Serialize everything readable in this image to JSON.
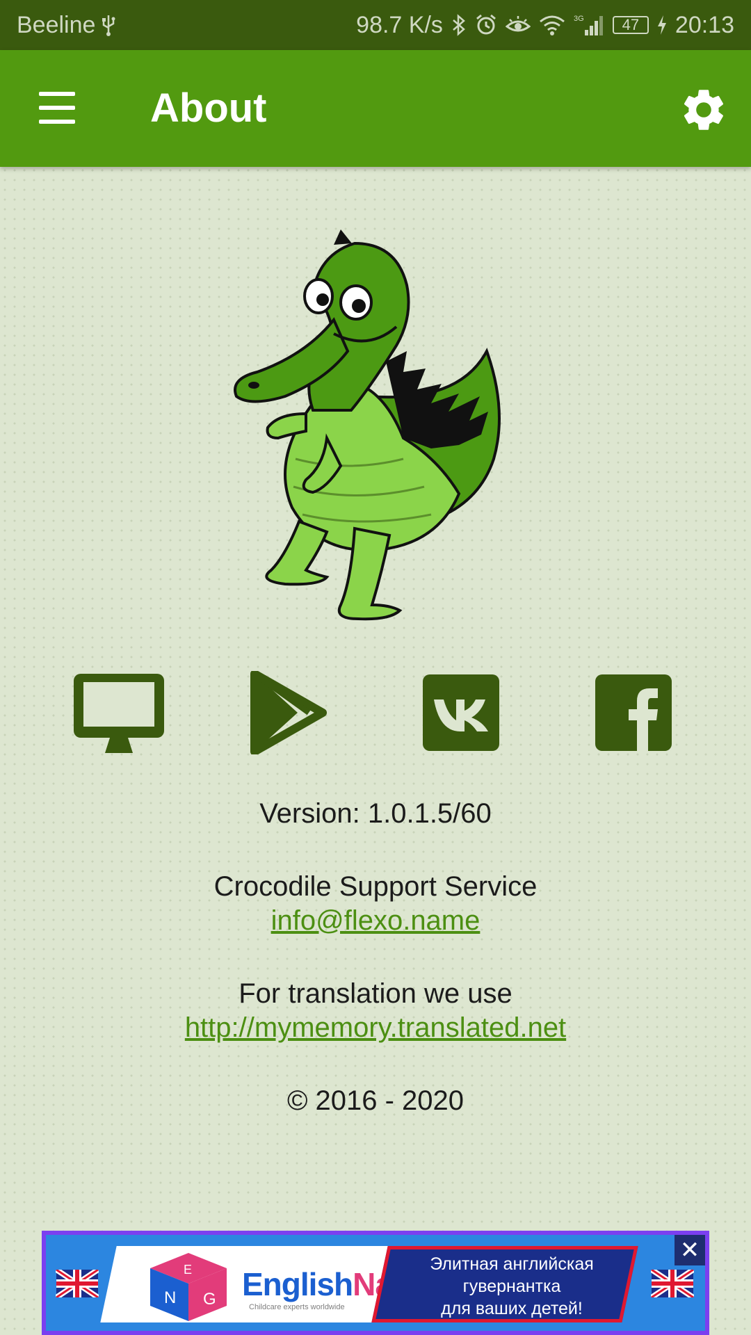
{
  "status_bar": {
    "carrier": "Beeline",
    "net_speed": "98.7 K/s",
    "network_type": "3G",
    "battery": "47",
    "time": "20:13"
  },
  "app_bar": {
    "title": "About"
  },
  "links": [
    {
      "name": "website",
      "icon": "monitor-icon"
    },
    {
      "name": "google-play",
      "icon": "play-store-icon"
    },
    {
      "name": "vk",
      "icon": "vk-icon"
    },
    {
      "name": "facebook",
      "icon": "facebook-icon"
    }
  ],
  "info": {
    "version": "Version: 1.0.1.5/60",
    "support_title": "Crocodile Support Service",
    "support_email": "info@flexo.name",
    "translation_title": "For translation we use",
    "translation_url": "http://mymemory.translated.net",
    "copyright": "© 2016 - 2020"
  },
  "ad": {
    "brand_part1": "English",
    "brand_part2": "Nanny",
    "brand_sub": "Childcare experts worldwide",
    "text_line1": "Элитная английская",
    "text_line2": "гувернантка",
    "text_line3": "для ваших детей!",
    "close_label": "✕",
    "cube_letters": [
      "E",
      "N",
      "G"
    ]
  },
  "colors": {
    "status_bar": "#3a5a0e",
    "app_bar": "#529a10",
    "background": "#dde6d0",
    "icons": "#3a5a0e",
    "link": "#4c8f12",
    "crocodile_dark": "#4c9a13",
    "crocodile_light": "#8bd44a"
  }
}
